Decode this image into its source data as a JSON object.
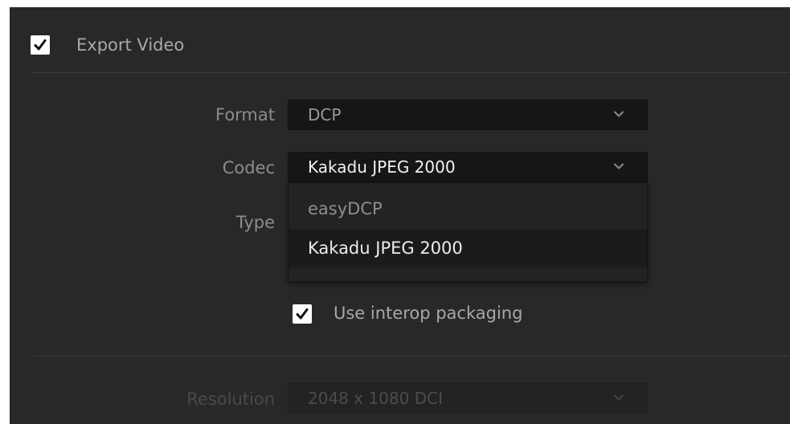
{
  "export_video": {
    "checked": true,
    "label": "Export Video"
  },
  "format": {
    "label": "Format",
    "value": "DCP"
  },
  "codec": {
    "label": "Codec",
    "value": "Kakadu JPEG 2000",
    "menu_open": true,
    "options": [
      "easyDCP",
      "Kakadu JPEG 2000"
    ],
    "highlighted_option": "Kakadu JPEG 2000"
  },
  "type": {
    "label": "Type"
  },
  "interop": {
    "checked": true,
    "label": "Use interop packaging"
  },
  "resolution": {
    "label": "Resolution",
    "value": "2048 x 1080 DCI",
    "disabled": true
  },
  "icons": {
    "checkmark": "checkmark-icon",
    "dropdown": "chevron-down-icon"
  },
  "colors": {
    "panel_bg": "#282828",
    "field_bg": "#161616",
    "text_primary": "#f0f0f0",
    "text_label": "#8d8d8d",
    "text_disabled": "#4c4c4c"
  }
}
